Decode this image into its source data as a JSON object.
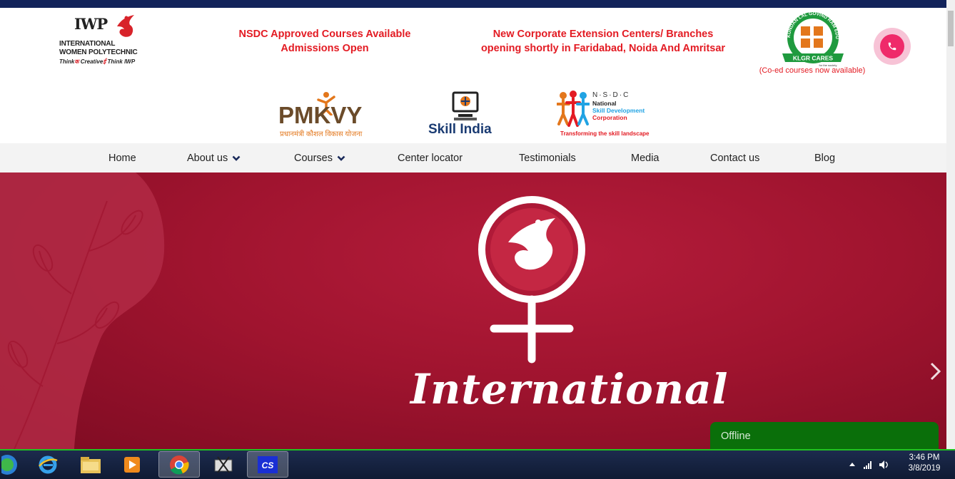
{
  "header": {
    "logo": {
      "name": "IWP",
      "line1": "INTERNATIONAL",
      "line2": "WOMEN POLYTECHNIC",
      "tagline": "Think Creative Think IWP",
      "tagline_think": "Think",
      "tagline_creative": "Creative",
      "tagline_think2": "Think",
      "tagline_iwp": "IWP"
    },
    "notice_1": [
      "NSDC Approved Courses Available",
      "Admissions Open"
    ],
    "notice_2": [
      "New Corporate Extension Centers/ Branches",
      "opening shortly in Faridabad, Noida And Amritsar"
    ],
    "klgr": {
      "ring_text": "KUNDAN LAL GOVIND RAM EDUCATIONAL SOCIETY",
      "banner": "KLGR CARES",
      "sub": "for the society",
      "caption": "(Co-ed courses now available)"
    },
    "phone_icon": "phone-icon",
    "partners": {
      "pmkvy": {
        "word": "PMKVY",
        "sub": "प्रधानमंत्री कौशल विकास योजना"
      },
      "skill_india": {
        "word": "Skill India"
      },
      "nsdc": {
        "abbr": "N·S·D·C",
        "line1": "National",
        "line2": "Skill Development",
        "line3": "Corporation",
        "tagline": "Transforming the skill landscape"
      }
    }
  },
  "nav": {
    "items": [
      {
        "label": "Home",
        "dropdown": false
      },
      {
        "label": "About us",
        "dropdown": true
      },
      {
        "label": "Courses",
        "dropdown": true
      },
      {
        "label": "Center locator",
        "dropdown": false
      },
      {
        "label": "Testimonials",
        "dropdown": false
      },
      {
        "label": "Media",
        "dropdown": false
      },
      {
        "label": "Contact us",
        "dropdown": false
      },
      {
        "label": "Blog",
        "dropdown": false
      }
    ]
  },
  "hero": {
    "title": "International",
    "next_icon": "chevron-right-icon",
    "colors": {
      "primary": "#a0142f",
      "dark": "#7d0b22"
    }
  },
  "chat": {
    "status": "Offline"
  },
  "taskbar": {
    "apps": [
      "start-orb",
      "internet-explorer",
      "file-explorer",
      "media-player",
      "chrome",
      "snipping-tool",
      "cs-app"
    ],
    "time": "3:46 PM",
    "date": "3/8/2019"
  },
  "colors": {
    "accent_red": "#e31b23",
    "nav_bg": "#f3f3f3",
    "topbar": "#12235a",
    "chat_green": "#0a6f0a"
  }
}
